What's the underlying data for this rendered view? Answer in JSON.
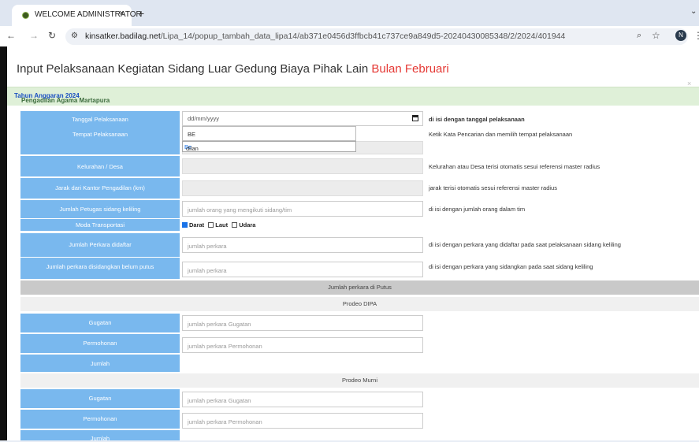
{
  "browser": {
    "tab_title": "WELCOME ADMINISTRATOR",
    "tab_close": "×",
    "new_tab": "+",
    "tab_menu": "⌄",
    "url_host": "kinsatker.badilag.net",
    "url_path": "/Lipa_14/popup_tambah_data_lipa14/ab371e0456d3ffbcb41c737ce9a849d5-20240430085348/2/2024/401944",
    "profile_initial": "N"
  },
  "page": {
    "title_main": "Input Pelaksanaan Kegiatan Sidang Luar Gedung Biaya Pihak Lain ",
    "title_highlight": "Bulan Februari",
    "close": "×",
    "court_name": "Pengadilan Agama Martapura ",
    "court_year": "Tahun Anggaran 2024"
  },
  "form": {
    "tanggal": {
      "label": "Tanggal Pelaksanaan",
      "placeholder": "dd/mm/yyyy",
      "help": "di isi dengan tanggal pelaksanaan"
    },
    "tempat": {
      "label": "Tempat Pelaksanaan",
      "value": "BE",
      "help": "Ketik Kata Pencarian dan memilih tempat pelaksanaan",
      "suggestion_match": "Be",
      "suggestion_rest": "dilan"
    },
    "kelurahan": {
      "label": "Kelurahan / Desa",
      "help": "Kelurahan atau Desa terisi otomatis sesui referensi master radius"
    },
    "jarak": {
      "label": "Jarak dari Kantor Pengadilan (km)",
      "help": "jarak terisi otomatis sesui referensi master radius"
    },
    "petugas": {
      "label": "Jumlah Petugas sidang keliling",
      "placeholder": "jumlah orang yang mengikuti sidang/tim",
      "help": "di isi dengan jumlah orang dalam tim"
    },
    "moda": {
      "label": "Moda Transportasi",
      "options": [
        {
          "label": "Darat",
          "checked": true
        },
        {
          "label": "Laut",
          "checked": false
        },
        {
          "label": "Udara",
          "checked": false
        }
      ]
    },
    "didaftar": {
      "label": "Jumlah Perkara didaftar",
      "placeholder": "jumlah perkara",
      "help": "di isi dengan perkara yang didaftar pada saat pelaksanaan sidang keliling"
    },
    "belum_putus": {
      "label": "Jumlah perkara disidangkan belum putus",
      "placeholder": "jumlah perkara",
      "help": "di isi dengan perkara yang sidangkan pada saat sidang keliling"
    }
  },
  "putus": {
    "header": "Jumlah perkara di Putus",
    "dipa": {
      "header": "Prodeo DIPA",
      "gugatan_label": "Gugatan",
      "gugatan_placeholder": "jumlah perkara Gugatan",
      "permohonan_label": "Permohonan",
      "permohonan_placeholder": "jumlah perkara Permohonan",
      "jumlah_label": "Jumlah"
    },
    "murni": {
      "header": "Prodeo Murni",
      "gugatan_label": "Gugatan",
      "gugatan_placeholder": "jumlah perkara Gugatan",
      "permohonan_label": "Permohonan",
      "permohonan_placeholder": "jumlah perkara Permohonan",
      "jumlah_label": "Jumlah"
    }
  },
  "icons": [
    "back-icon",
    "forward-icon",
    "reload-icon",
    "site-info-icon",
    "zoom-icon",
    "bookmark-star-icon",
    "more-icon",
    "calendar-icon"
  ]
}
